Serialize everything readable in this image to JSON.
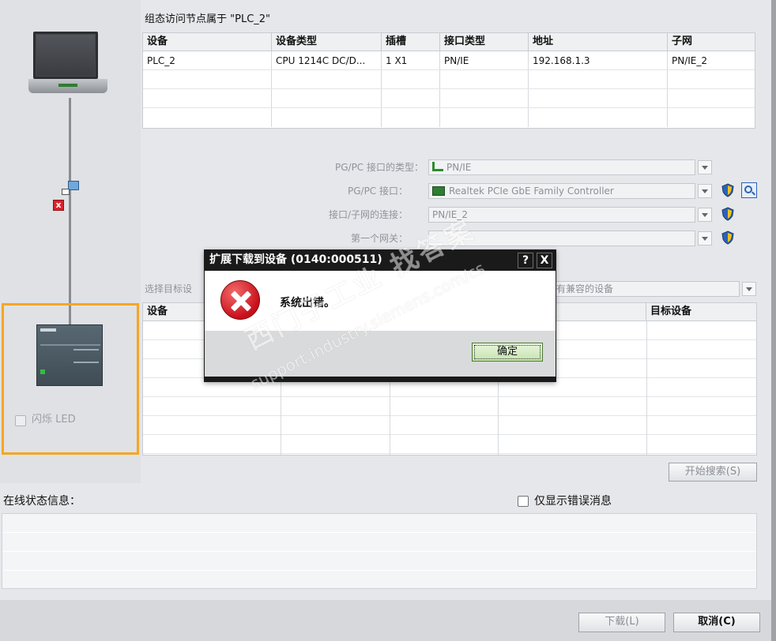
{
  "nodes": {
    "title": "组态访问节点属于 \"PLC_2\"",
    "columns": [
      "设备",
      "设备类型",
      "插槽",
      "接口类型",
      "地址",
      "子网"
    ],
    "rows": [
      [
        "PLC_2",
        "CPU 1214C DC/D...",
        "1 X1",
        "PN/IE",
        "192.168.1.3",
        "PN/IE_2"
      ]
    ]
  },
  "interface": {
    "type_label": "PG/PC 接口的类型：",
    "type_value": "PN/IE",
    "iface_label": "PG/PC 接口：",
    "iface_value": "Realtek PCIe GbE Family Controller",
    "subnet_label": "接口/子网的连接：",
    "subnet_value": "PN/IE_2",
    "gateway_label": "第一个网关：",
    "gateway_value": ""
  },
  "target": {
    "select_label": "选择目标设",
    "select_value": "有兼容的设备",
    "columns": [
      "设备",
      "目标设备"
    ],
    "search_button": "开始搜索(S)"
  },
  "left": {
    "flash_led": "闪烁 LED"
  },
  "status": {
    "title": "在线状态信息：",
    "errors_only": "仅显示错误消息"
  },
  "footer": {
    "download": "下载(L)",
    "cancel": "取消(C)"
  },
  "dialog": {
    "title": "扩展下载到设备 (0140:000511)",
    "help": "?",
    "close": "X",
    "message": "系统出错。",
    "ok": "确定"
  },
  "watermark": {
    "line1": "西门子工业 找答案",
    "line2": "support.industry.siemens.com/cs"
  },
  "colors": {
    "accent": "#f5a623",
    "error": "#d9232e",
    "dialog_title": "#1a1a1a"
  }
}
